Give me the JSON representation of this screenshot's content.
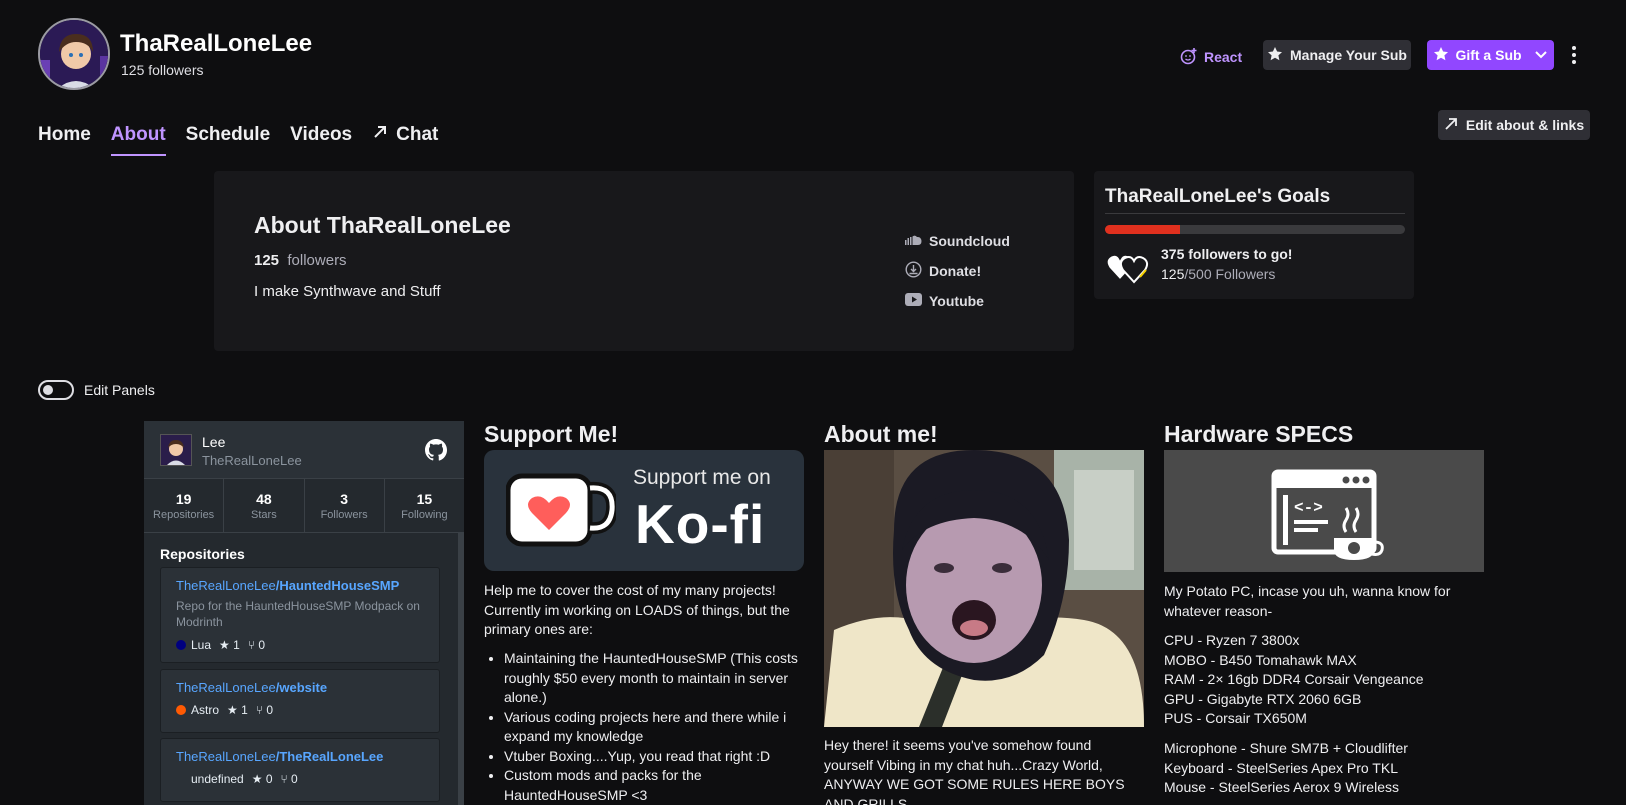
{
  "channel": {
    "name": "ThaRealLoneLee",
    "followers_text": "125 followers"
  },
  "actions": {
    "react": "React",
    "manage_sub": "Manage Your Sub",
    "gift_sub": "Gift a Sub"
  },
  "tabs": [
    {
      "label": "Home"
    },
    {
      "label": "About",
      "active": true
    },
    {
      "label": "Schedule"
    },
    {
      "label": "Videos"
    },
    {
      "label": "Chat"
    }
  ],
  "edit_about_links": "Edit about & links",
  "about": {
    "title": "About ThaRealLoneLee",
    "followers_count": "125",
    "followers_label": "followers",
    "description": "I make Synthwave and Stuff",
    "links": [
      {
        "label": "Soundcloud",
        "icon": "soundcloud-icon"
      },
      {
        "label": "Donate!",
        "icon": "donate-icon"
      },
      {
        "label": "Youtube",
        "icon": "youtube-icon"
      }
    ]
  },
  "goals": {
    "title": "ThaRealLoneLee's Goals",
    "remaining": "375 followers to go!",
    "current": "125",
    "target_text": "/500 Followers",
    "progress": 0.25,
    "bar_color": "#e0301e"
  },
  "edit_panels": "Edit Panels",
  "github": {
    "name": "Lee",
    "username": "TheRealLoneLee",
    "stats": [
      {
        "value": "19",
        "label": "Repositories"
      },
      {
        "value": "48",
        "label": "Stars"
      },
      {
        "value": "3",
        "label": "Followers"
      },
      {
        "value": "15",
        "label": "Following"
      }
    ],
    "repos_title": "Repositories",
    "repos": [
      {
        "owner": "TheRealLoneLee",
        "name": "/HauntedHouseSMP",
        "desc": "Repo for the HauntedHouseSMP Modpack on Modrinth",
        "lang": "Lua",
        "lang_color": "#000080",
        "stars": "1",
        "forks": "0"
      },
      {
        "owner": "TheRealLoneLee",
        "name": "/website",
        "desc": "",
        "lang": "Astro",
        "lang_color": "#ff5a03",
        "stars": "1",
        "forks": "0"
      },
      {
        "owner": "TheRealLoneLee",
        "name": "/TheRealLoneLee",
        "desc": "",
        "lang": "undefined",
        "lang_color": "",
        "stars": "0",
        "forks": "0"
      }
    ]
  },
  "panels": {
    "support": {
      "title": "Support Me!",
      "kofi_small": "Support me on",
      "kofi_big": "Ko-fi",
      "intro": "Help me to cover the cost of my many projects! Currently im working on LOADS of things, but the primary ones are:",
      "items": [
        "Maintaining the HauntedHouseSMP (This costs roughly $50 every month to maintain in server alone.)",
        "Various coding projects here and there while i expand my knowledge",
        "Vtuber Boxing....Yup, you read that right :D",
        "Custom mods and packs for the HauntedHouseSMP <3"
      ]
    },
    "about_me": {
      "title": "About me!",
      "text": "Hey there! it seems you've somehow found yourself Vibing in my chat huh...Crazy World, ANYWAY WE GOT SOME RULES HERE BOYS AND GRILLS"
    },
    "hardware": {
      "title": "Hardware SPECS",
      "intro": "My Potato PC, incase you uh, wanna know for whatever reason-",
      "specs": [
        "CPU - Ryzen 7 3800x",
        "MOBO - B450 Tomahawk MAX",
        "RAM - 2× 16gb DDR4 Corsair Vengeance",
        "GPU - Gigabyte RTX 2060 6GB",
        "PUS - Corsair TX650M"
      ],
      "peripherals": [
        "Microphone - Shure SM7B + Cloudlifter",
        "Keyboard - SteelSeries Apex Pro TKL",
        "Mouse - SteelSeries Aerox 9 Wireless"
      ]
    }
  }
}
